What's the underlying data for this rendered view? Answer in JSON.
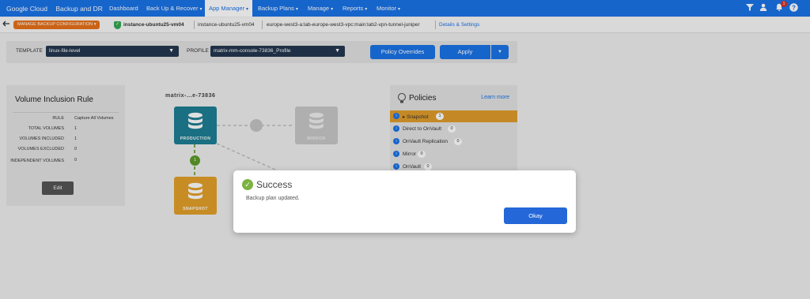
{
  "topnav": {
    "brand_google": "Google Cloud",
    "brand_product": "Backup and DR",
    "items": [
      {
        "label": "Dashboard",
        "caret": ""
      },
      {
        "label": "Back Up & Recover",
        "caret": "▾"
      },
      {
        "label": "App Manager",
        "caret": "▾"
      },
      {
        "label": "Backup Plans",
        "caret": "▾"
      },
      {
        "label": "Manage",
        "caret": "▾"
      },
      {
        "label": "Reports",
        "caret": "▾"
      },
      {
        "label": "Monitor",
        "caret": "▾"
      }
    ],
    "active_item": "App Manager",
    "notification_count": "1"
  },
  "crumbbar": {
    "manage_button": "MANAGE BACKUP CONFIGURATION",
    "manage_caret": "▾",
    "crumbs": [
      "instance-ubuntu25-vm04",
      "instance-ubuntu25-vm04",
      "europe-west3-a:lab-europe-west3-vpc:main:lab2-vpn-tunnel-juniper"
    ],
    "details_link": "Details & Settings"
  },
  "toolbar": {
    "template_label": "TEMPLATE",
    "template_value": "linux-file-level",
    "profile_label": "PROFILE",
    "profile_value": "matrix-mm-console-73836_Profile",
    "policy_overrides": "Policy Overrides",
    "apply": "Apply"
  },
  "volume_rule": {
    "title": "Volume Inclusion Rule",
    "rows": [
      {
        "key": "RULE",
        "value": "Capture All Volumes"
      },
      {
        "key": "TOTAL VOLUMES",
        "value": "1"
      },
      {
        "key": "VOLUMES INCLUDED",
        "value": "1"
      },
      {
        "key": "VOLUMES EXCLUDED",
        "value": "0"
      },
      {
        "key": "INDEPENDENT VOLUMES",
        "value": "0"
      }
    ],
    "edit": "Edit"
  },
  "diagram": {
    "title": "matrix-...e-73836",
    "production": "PRODUCTION",
    "snapshot": "SNAPSHOT",
    "mirror": "MIRROR",
    "policy_number": "1",
    "colors": {
      "production": "#1e7f94",
      "snapshot": "#e3a02a",
      "mirror": "#c8c8c8",
      "connector": "#5c9b2a"
    }
  },
  "policies": {
    "title": "Policies",
    "learn_more": "Learn more",
    "rows": [
      {
        "name": "Snapshot",
        "count": "1",
        "selected": true
      },
      {
        "name": "Direct to OnVault",
        "count": "0",
        "selected": false
      },
      {
        "name": "OnVault Replication",
        "count": "0",
        "selected": false
      },
      {
        "name": "Mirror",
        "count": "0",
        "selected": false
      },
      {
        "name": "OnVault",
        "count": "0",
        "selected": false
      }
    ]
  },
  "modal": {
    "title": "Success",
    "message": "Backup plan updated.",
    "okay": "Okay"
  }
}
